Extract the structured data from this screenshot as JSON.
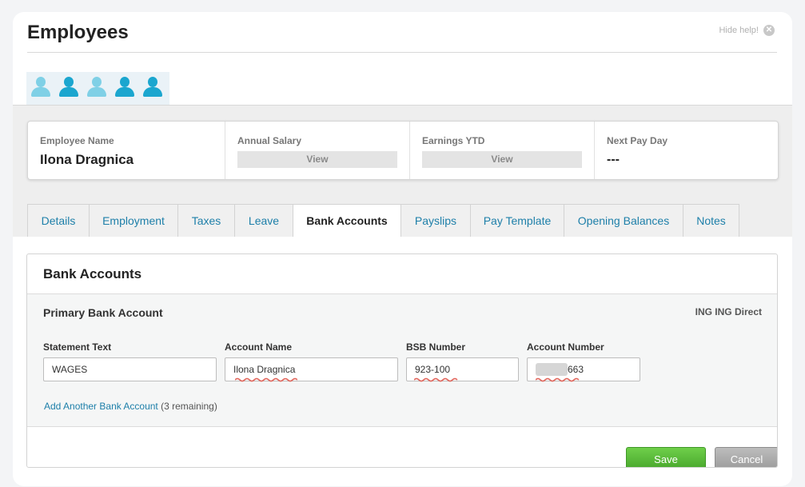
{
  "header": {
    "title": "Employees",
    "hide_help": "Hide help!",
    "close_glyph": "✕"
  },
  "avatars": [
    "light",
    "dark",
    "light",
    "dark",
    "dark"
  ],
  "summary": {
    "employee_name_label": "Employee Name",
    "employee_name": "Ilona Dragnica",
    "annual_salary_label": "Annual Salary",
    "annual_salary_view": "View",
    "earnings_ytd_label": "Earnings YTD",
    "earnings_ytd_view": "View",
    "next_pay_day_label": "Next Pay Day",
    "next_pay_day": "---"
  },
  "tabs": [
    {
      "label": "Details"
    },
    {
      "label": "Employment"
    },
    {
      "label": "Taxes"
    },
    {
      "label": "Leave"
    },
    {
      "label": "Bank Accounts"
    },
    {
      "label": "Payslips"
    },
    {
      "label": "Pay Template"
    },
    {
      "label": "Opening Balances"
    },
    {
      "label": "Notes"
    }
  ],
  "active_tab": "Bank Accounts",
  "bank_accounts": {
    "title": "Bank Accounts",
    "primary_title": "Primary Bank Account",
    "bank_name": "ING ING Direct",
    "fields": {
      "statement_text": {
        "label": "Statement Text",
        "value": "WAGES"
      },
      "account_name": {
        "label": "Account Name",
        "value": "Ilona Dragnica"
      },
      "bsb_number": {
        "label": "BSB Number",
        "value": "923-100"
      },
      "account_number": {
        "label": "Account Number",
        "value": "663"
      }
    },
    "add_link": "Add Another Bank Account",
    "remaining": "(3 remaining)"
  },
  "actions": {
    "save": "Save",
    "cancel": "Cancel"
  },
  "colors": {
    "link": "#1d7fa9",
    "save": "#55b834",
    "cancel": "#a8a8a8",
    "spell_squiggle": "#e0665c"
  }
}
